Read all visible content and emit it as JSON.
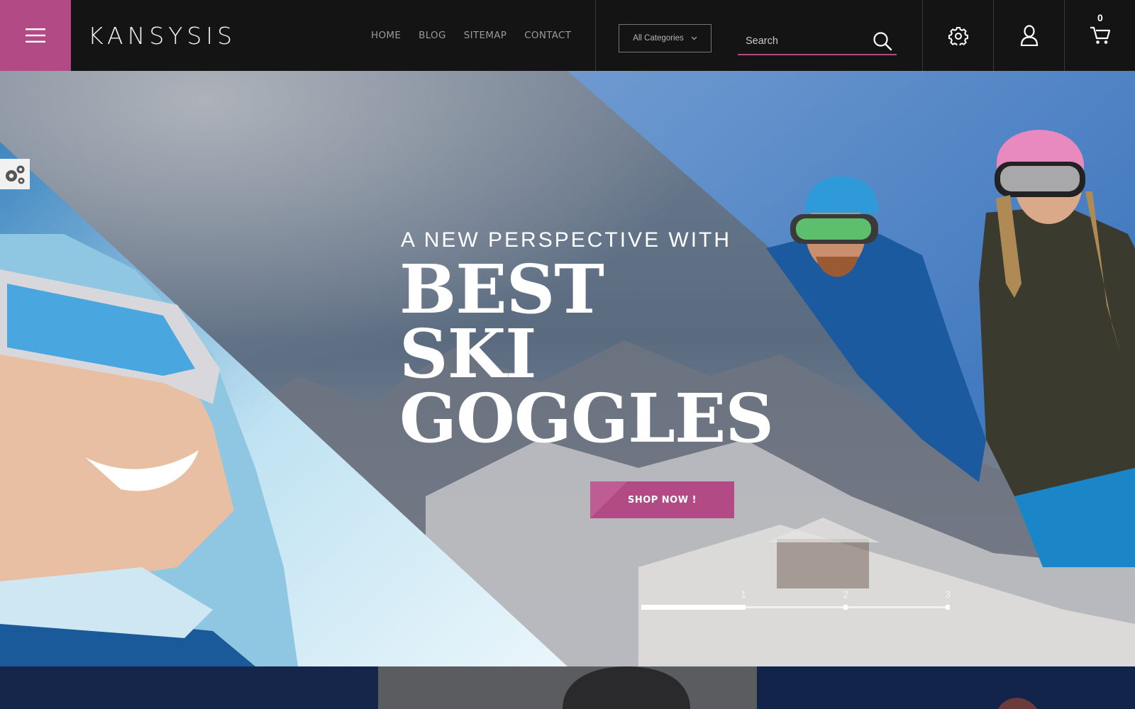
{
  "brand": {
    "logo_text": "KANSYSIS",
    "accent_color": "#b24a86"
  },
  "header": {
    "menu_icon": "hamburger-icon",
    "nav": [
      {
        "label": "HOME"
      },
      {
        "label": "BLOG"
      },
      {
        "label": "SITEMAP"
      },
      {
        "label": "CONTACT"
      }
    ],
    "category_select": {
      "selected": "All Categories",
      "icon": "chevron-down-icon"
    },
    "search": {
      "placeholder": "Search",
      "value": "",
      "icon": "search-icon"
    },
    "settings_icon": "gear-icon",
    "account_icon": "user-icon",
    "cart": {
      "icon": "cart-icon",
      "count": "0"
    }
  },
  "hero": {
    "subtitle": "A NEW PERSPECTIVE WITH",
    "title_lines": [
      "BEST",
      "SKI",
      "GOGGLES"
    ],
    "cta_label": "SHOP NOW !",
    "slider": {
      "slides": [
        "1",
        "2",
        "3"
      ],
      "active_slide": 1
    },
    "panel_toggle_icon": "gears-icon"
  }
}
